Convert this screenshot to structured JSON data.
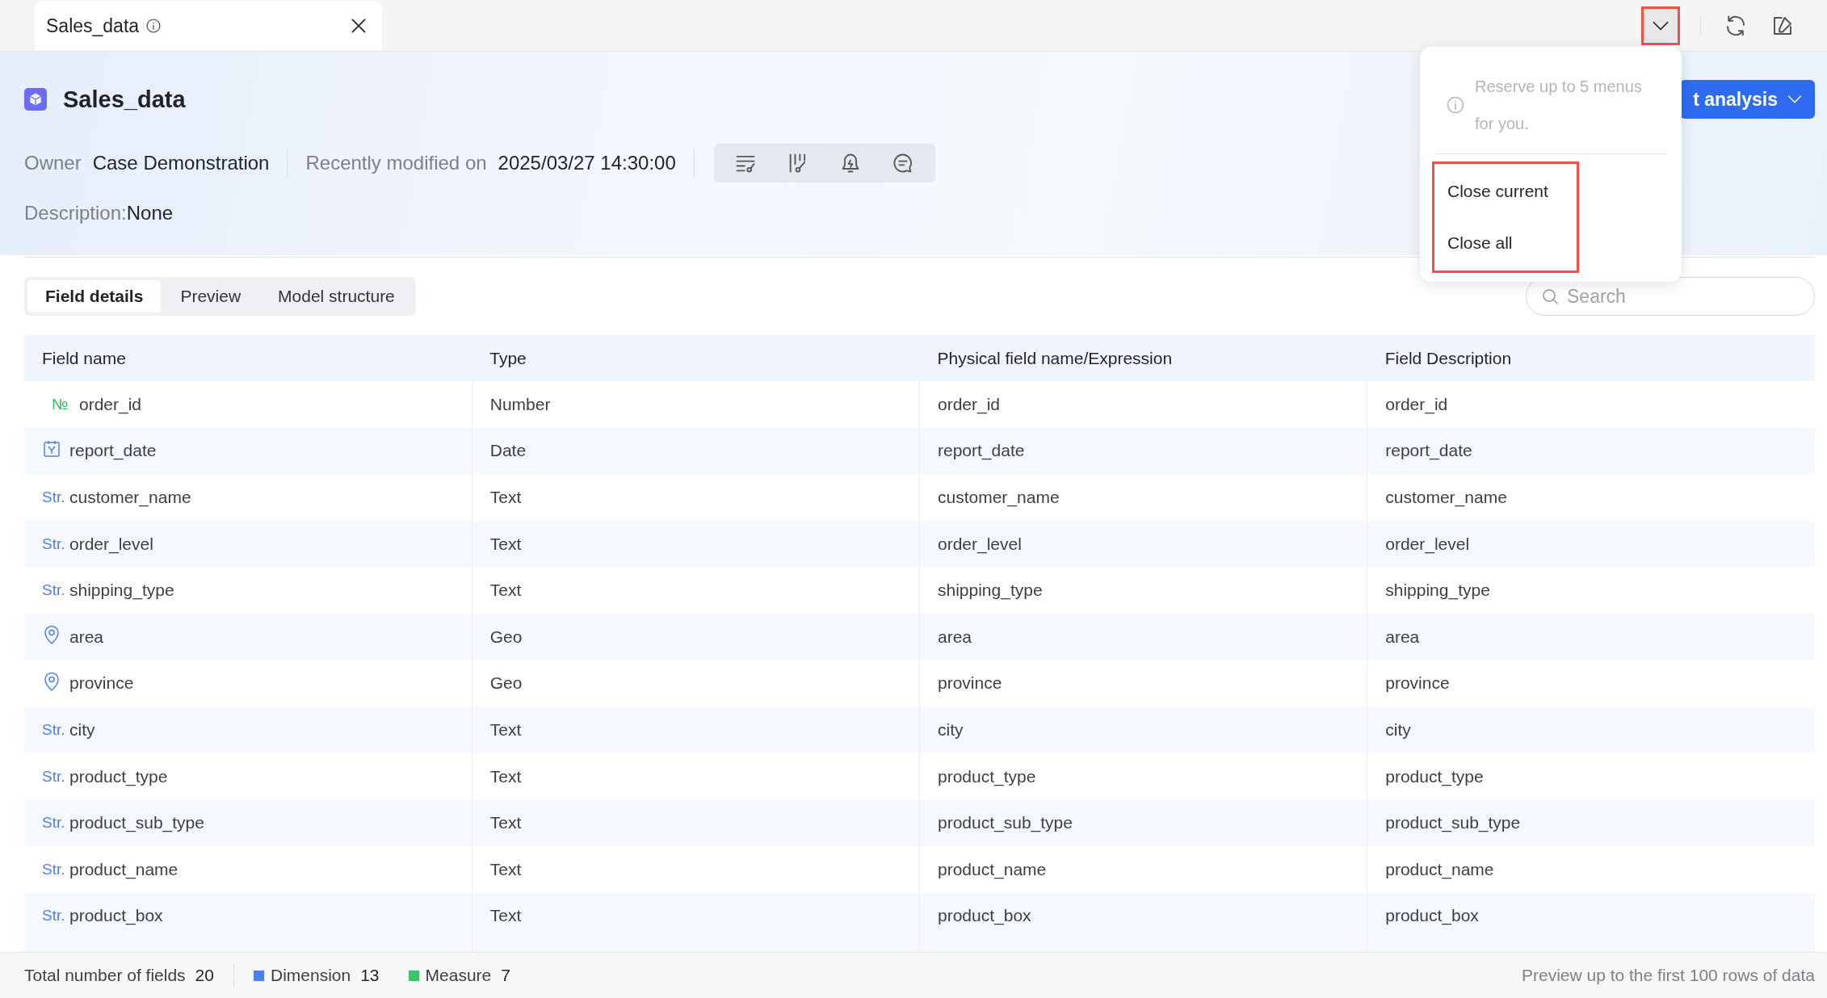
{
  "tab_bar": {
    "tabs": [
      {
        "label": "Sales_data",
        "selected": true
      }
    ],
    "menu_button": {
      "highlighted": true
    }
  },
  "header": {
    "title": "Sales_data",
    "owner_label": "Owner",
    "owner": "Case Demonstration",
    "modified_label": "Recently modified on",
    "modified": "2025/03/27 14:30:00",
    "description_label": "Description:",
    "description": "None",
    "primary_button": "t analysis"
  },
  "view_tabs": [
    {
      "label": "Field details",
      "selected": true
    },
    {
      "label": "Preview",
      "selected": false
    },
    {
      "label": "Model structure",
      "selected": false
    }
  ],
  "search": {
    "placeholder": "Search"
  },
  "table": {
    "columns": [
      "Field name",
      "Type",
      "Physical field name/Expression",
      "Field Description"
    ],
    "rows": [
      {
        "kind": "number",
        "badge": "№",
        "field_name": "order_id",
        "type": "Number",
        "physical": "order_id",
        "description": "order_id"
      },
      {
        "kind": "date",
        "field_name": "report_date",
        "type": "Date",
        "physical": "report_date",
        "description": "report_date"
      },
      {
        "kind": "text",
        "badge": "Str.",
        "field_name": "customer_name",
        "type": "Text",
        "physical": "customer_name",
        "description": "customer_name"
      },
      {
        "kind": "text",
        "badge": "Str.",
        "field_name": "order_level",
        "type": "Text",
        "physical": "order_level",
        "description": "order_level"
      },
      {
        "kind": "text",
        "badge": "Str.",
        "field_name": "shipping_type",
        "type": "Text",
        "physical": "shipping_type",
        "description": "shipping_type"
      },
      {
        "kind": "geo",
        "field_name": "area",
        "type": "Geo",
        "physical": "area",
        "description": "area"
      },
      {
        "kind": "geo",
        "field_name": "province",
        "type": "Geo",
        "physical": "province",
        "description": "province"
      },
      {
        "kind": "text",
        "badge": "Str.",
        "field_name": "city",
        "type": "Text",
        "physical": "city",
        "description": "city"
      },
      {
        "kind": "text",
        "badge": "Str.",
        "field_name": "product_type",
        "type": "Text",
        "physical": "product_type",
        "description": "product_type"
      },
      {
        "kind": "text",
        "badge": "Str.",
        "field_name": "product_sub_type",
        "type": "Text",
        "physical": "product_sub_type",
        "description": "product_sub_type"
      },
      {
        "kind": "text",
        "badge": "Str.",
        "field_name": "product_name",
        "type": "Text",
        "physical": "product_name",
        "description": "product_name"
      },
      {
        "kind": "text",
        "badge": "Str.",
        "field_name": "product_box",
        "type": "Text",
        "physical": "product_box",
        "description": "product_box"
      }
    ]
  },
  "footer": {
    "total_label": "Total number of fields",
    "total": "20",
    "legend": [
      {
        "label": "Dimension",
        "count": "13",
        "color": "#4d7ff0"
      },
      {
        "label": "Measure",
        "count": "7",
        "color": "#3cc46a"
      }
    ],
    "note": "Preview up to the first 100 rows of data"
  },
  "menu": {
    "note": "Reserve up to 5 menus for you.",
    "highlighted": true,
    "items": [
      {
        "label": "Close current"
      },
      {
        "label": "Close all"
      }
    ]
  }
}
